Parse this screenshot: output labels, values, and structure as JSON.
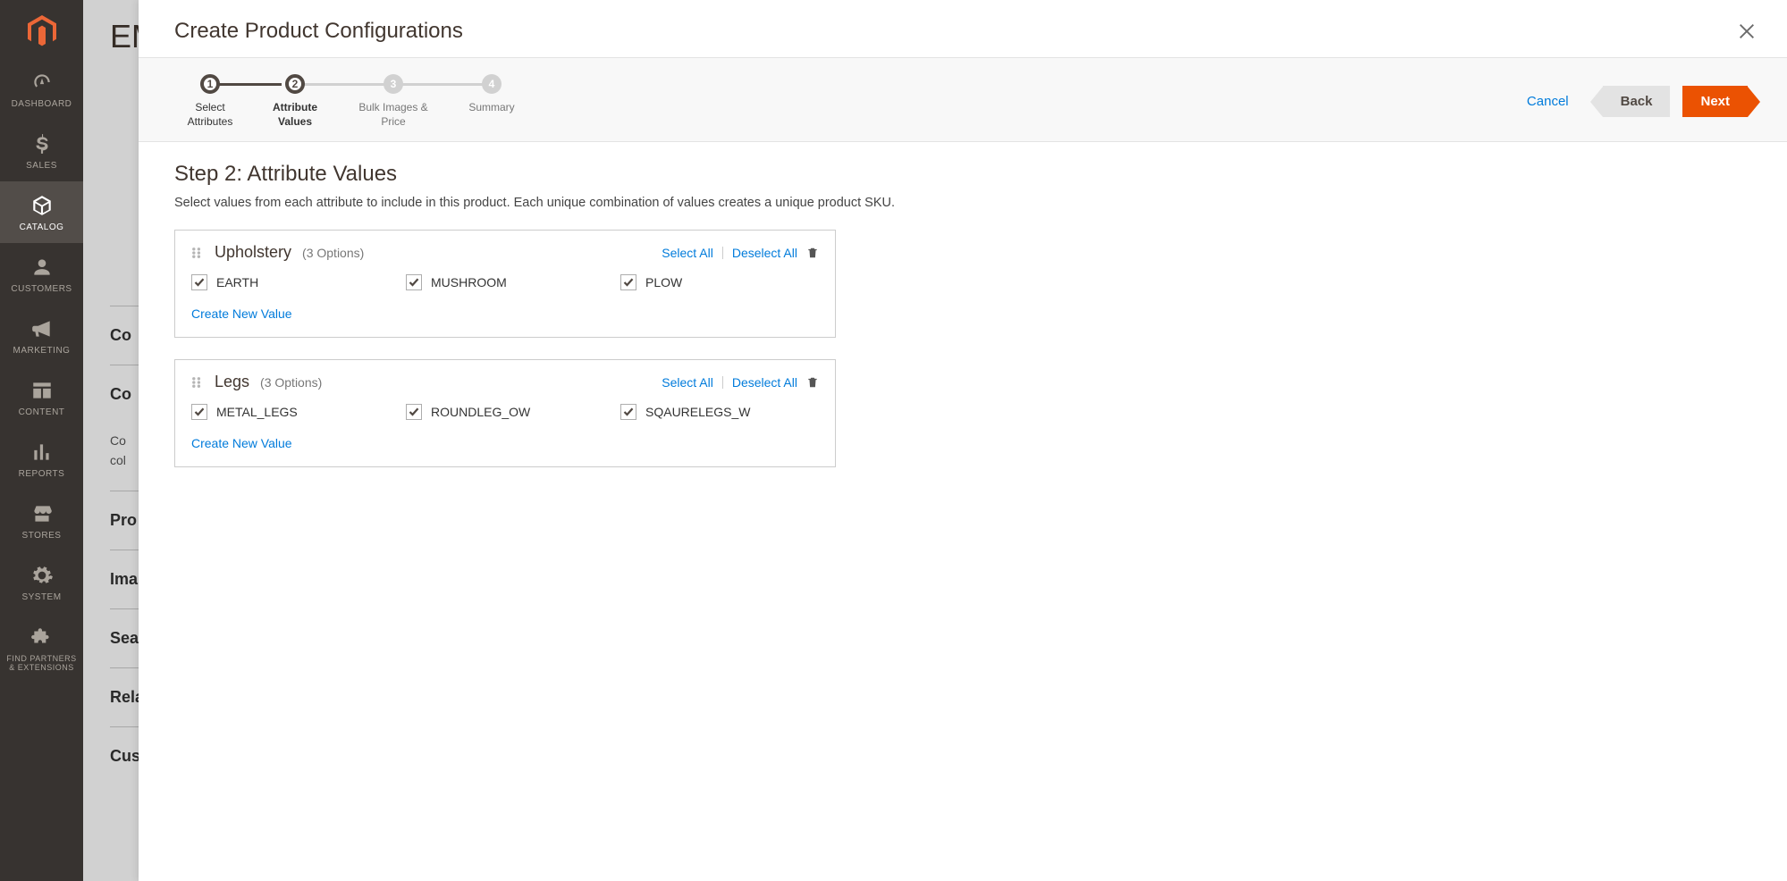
{
  "sidebar": {
    "items": [
      {
        "label": "DASHBOARD"
      },
      {
        "label": "SALES"
      },
      {
        "label": "CATALOG"
      },
      {
        "label": "CUSTOMERS"
      },
      {
        "label": "MARKETING"
      },
      {
        "label": "CONTENT"
      },
      {
        "label": "REPORTS"
      },
      {
        "label": "STORES"
      },
      {
        "label": "SYSTEM"
      },
      {
        "label": "FIND PARTNERS & EXTENSIONS"
      }
    ]
  },
  "bgPage": {
    "title": "EM",
    "sections": [
      "Co",
      "Co",
      "Pro",
      "Ima",
      "Sea",
      "Rela",
      "Cus"
    ],
    "note1": "Co",
    "note2": "col"
  },
  "modal": {
    "title": "Create Product Configurations",
    "steps": [
      {
        "num": "1",
        "label": "Select Attributes"
      },
      {
        "num": "2",
        "label": "Attribute Values"
      },
      {
        "num": "3",
        "label": "Bulk Images & Price"
      },
      {
        "num": "4",
        "label": "Summary"
      }
    ],
    "actions": {
      "cancel": "Cancel",
      "back": "Back",
      "next": "Next"
    },
    "heading": "Step 2: Attribute Values",
    "desc": "Select values from each attribute to include in this product. Each unique combination of values creates a unique product SKU.",
    "links": {
      "selectAll": "Select All",
      "deselectAll": "Deselect All",
      "createNew": "Create New Value"
    },
    "attributes": [
      {
        "name": "Upholstery",
        "count": "(3 Options)",
        "values": [
          "EARTH",
          "MUSHROOM",
          "PLOW"
        ]
      },
      {
        "name": "Legs",
        "count": "(3 Options)",
        "values": [
          "METAL_LEGS",
          "ROUNDLEG_OW",
          "SQAURELEGS_W"
        ]
      }
    ]
  }
}
